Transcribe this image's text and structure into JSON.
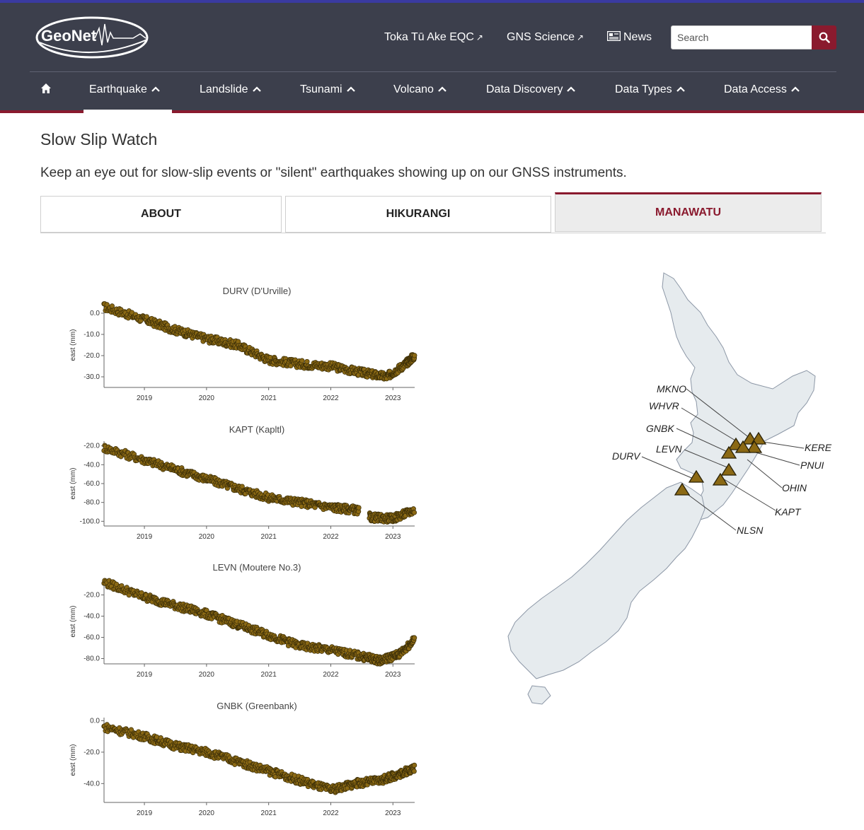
{
  "header": {
    "logo_text": "GeoNet",
    "links": [
      {
        "label": "Toka Tū Ake EQC",
        "external": true
      },
      {
        "label": "GNS Science",
        "external": true
      },
      {
        "label": "News",
        "icon": "newspaper-icon"
      }
    ],
    "search_placeholder": "Search",
    "nav": [
      {
        "label": "Earthquake",
        "active": true
      },
      {
        "label": "Landslide"
      },
      {
        "label": "Tsunami"
      },
      {
        "label": "Volcano"
      },
      {
        "label": "Data Discovery"
      },
      {
        "label": "Data Types"
      },
      {
        "label": "Data Access"
      }
    ],
    "colors": {
      "bar": "#3c3f4c",
      "accent": "#8a1a2e"
    }
  },
  "page": {
    "title": "Slow Slip Watch",
    "description": "Keep an eye out for slow-slip events or \"silent\" earthquakes showing up on our GNSS instruments.",
    "tabs": [
      {
        "label": "ABOUT"
      },
      {
        "label": "HIKURANGI"
      },
      {
        "label": "MANAWATU",
        "active": true
      }
    ]
  },
  "chart_data": [
    {
      "type": "scatter",
      "title": "DURV (D'Urville)",
      "ylabel": "east (mm)",
      "xlim": [
        2018.35,
        2023.35
      ],
      "ylim": [
        -35,
        5
      ],
      "x_ticks": [
        "2019",
        "2020",
        "2021",
        "2022",
        "2023"
      ],
      "y_ticks": [
        "0.0",
        "-10.0",
        "-20.0",
        "-30.0"
      ],
      "series": [
        {
          "points": [
            [
              2018.35,
              3
            ],
            [
              2019.0,
              -3
            ],
            [
              2019.5,
              -8
            ],
            [
              2020.0,
              -12
            ],
            [
              2020.5,
              -15
            ],
            [
              2021.0,
              -22
            ],
            [
              2021.5,
              -24
            ],
            [
              2022.0,
              -25
            ],
            [
              2022.5,
              -28
            ],
            [
              2022.9,
              -30
            ],
            [
              2023.2,
              -24
            ],
            [
              2023.35,
              -20
            ]
          ]
        }
      ],
      "color": "#8b6914"
    },
    {
      "type": "scatter",
      "title": "KAPT (Kapltl)",
      "ylabel": "east (mm)",
      "xlim": [
        2018.35,
        2023.35
      ],
      "ylim": [
        -105,
        -15
      ],
      "x_ticks": [
        "2019",
        "2020",
        "2021",
        "2022",
        "2023"
      ],
      "y_ticks": [
        "-20.0",
        "-40.0",
        "-60.0",
        "-80.0",
        "-100.0"
      ],
      "series": [
        {
          "points": [
            [
              2018.35,
              -22
            ],
            [
              2019.0,
              -35
            ],
            [
              2019.5,
              -45
            ],
            [
              2020.0,
              -55
            ],
            [
              2020.5,
              -65
            ],
            [
              2021.0,
              -75
            ],
            [
              2021.5,
              -80
            ],
            [
              2022.0,
              -85
            ],
            [
              2022.4,
              -88
            ],
            [
              2022.65,
              -96
            ],
            [
              2023.0,
              -97
            ],
            [
              2023.35,
              -88
            ]
          ]
        }
      ],
      "color": "#8b6914"
    },
    {
      "type": "scatter",
      "title": "LEVN (Moutere No.3)",
      "ylabel": "east (mm)",
      "xlim": [
        2018.35,
        2023.35
      ],
      "ylim": [
        -85,
        -5
      ],
      "x_ticks": [
        "2019",
        "2020",
        "2021",
        "2022",
        "2023"
      ],
      "y_ticks": [
        "-20.0",
        "-40.0",
        "-60.0",
        "-80.0"
      ],
      "series": [
        {
          "points": [
            [
              2018.35,
              -8
            ],
            [
              2019.0,
              -22
            ],
            [
              2019.5,
              -30
            ],
            [
              2020.0,
              -38
            ],
            [
              2020.5,
              -48
            ],
            [
              2021.0,
              -58
            ],
            [
              2021.5,
              -68
            ],
            [
              2022.0,
              -72
            ],
            [
              2022.5,
              -78
            ],
            [
              2022.8,
              -82
            ],
            [
              2023.1,
              -76
            ],
            [
              2023.35,
              -62
            ]
          ]
        }
      ],
      "color": "#8b6914"
    },
    {
      "type": "scatter",
      "title": "GNBK (Greenbank)",
      "ylabel": "east (mm)",
      "xlim": [
        2018.35,
        2023.35
      ],
      "ylim": [
        -52,
        2
      ],
      "x_ticks": [
        "2019",
        "2020",
        "2021",
        "2022",
        "2023"
      ],
      "y_ticks": [
        "0.0",
        "-20.0",
        "-40.0"
      ],
      "series": [
        {
          "points": [
            [
              2018.35,
              -4
            ],
            [
              2019.0,
              -10
            ],
            [
              2019.5,
              -16
            ],
            [
              2020.0,
              -20
            ],
            [
              2020.5,
              -26
            ],
            [
              2021.0,
              -32
            ],
            [
              2021.5,
              -38
            ],
            [
              2022.0,
              -44
            ],
            [
              2022.4,
              -40
            ],
            [
              2022.8,
              -38
            ],
            [
              2023.1,
              -34
            ],
            [
              2023.35,
              -30
            ]
          ]
        }
      ],
      "color": "#8b6914"
    }
  ],
  "map": {
    "sites": [
      "MKNO",
      "WHVR",
      "GNBK",
      "LEVN",
      "DURV",
      "KERE",
      "PNUI",
      "OHIN",
      "KAPT",
      "NLSN"
    ],
    "marker_color": "#8b6914",
    "land_color": "#e6ebee"
  }
}
